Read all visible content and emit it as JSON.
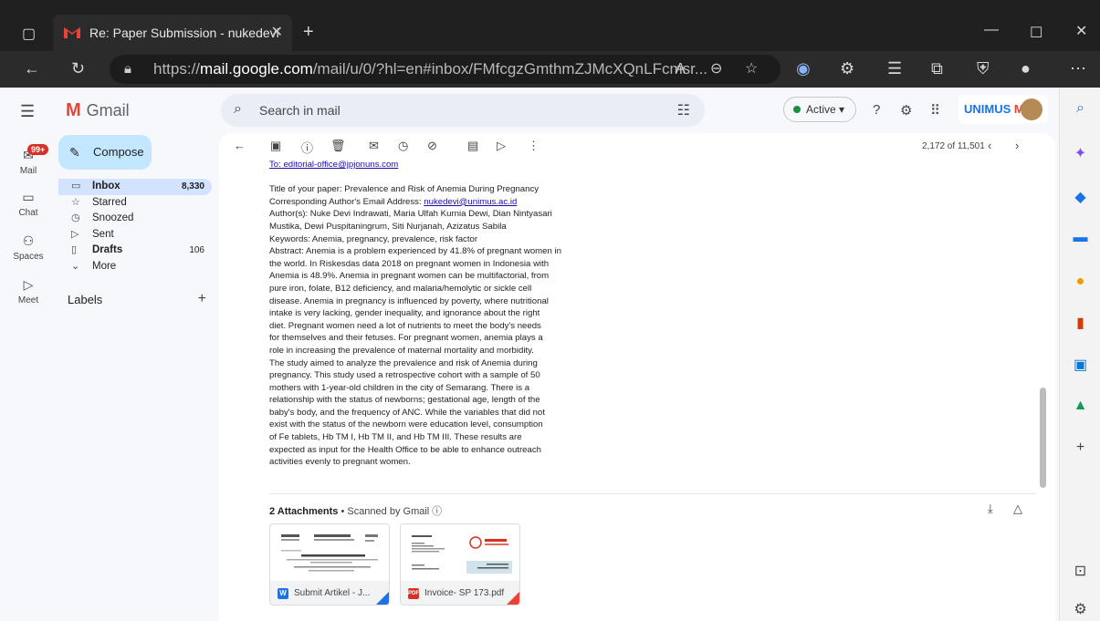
{
  "browser": {
    "tab_title": "Re: Paper Submission - nukedevi",
    "tab_close": "✕",
    "new_tab": "+",
    "url_prefix": "https://",
    "url_domain": "mail.google.com",
    "url_rest": "/mail/u/0/?hl=en#inbox/FMfcgzGmthmZJMcXQnLFcmsr..."
  },
  "gmail": {
    "app_name": "Gmail",
    "search_placeholder": "Search in mail",
    "status": "Active",
    "brand_text": "UNIMUS",
    "brand_mg": "MG"
  },
  "rail": {
    "mail": "Mail",
    "mail_badge": "99+",
    "chat": "Chat",
    "spaces": "Spaces",
    "meet": "Meet"
  },
  "sidebar": {
    "compose": "Compose",
    "folders": [
      {
        "label": "Inbox",
        "count": "8,330"
      },
      {
        "label": "Starred",
        "count": ""
      },
      {
        "label": "Snoozed",
        "count": ""
      },
      {
        "label": "Sent",
        "count": ""
      },
      {
        "label": "Drafts",
        "count": "106"
      },
      {
        "label": "More",
        "count": ""
      }
    ],
    "labels_title": "Labels"
  },
  "toolbar": {
    "pager": "2,172 of 11,501"
  },
  "email": {
    "to_line": "To: editorial-office@jpjonuns.com",
    "paper_title": "Title of your paper: Prevalence and Risk of Anemia During Pregnancy",
    "corr_prefix": "Corresponding Author's Email Address: ",
    "corr_email": "nukedevi@unimus.ac.id",
    "authors_1": "Author(s): Nuke Devi Indrawati, Maria Ulfah Kurnia Dewi, Dian Nintyasari",
    "authors_2": "Mustika, Dewi Puspitaningrum, Siti Nurjanah, Azizatus Sabila",
    "keywords": "Keywords: Anemia, pregnancy, prevalence, risk factor",
    "abstract_lines": [
      "Abstract: Anemia is a problem experienced by 41.8% of pregnant women in",
      "the world. In Riskesdas data 2018 on pregnant women in Indonesia with",
      "Anemia is 48.9%. Anemia in pregnant women can be multifactorial, from",
      "pure iron, folate, B12 deficiency, and malaria/hemolytic or sickle cell",
      "disease. Anemia in pregnancy is influenced by poverty, where nutritional",
      "intake is very lacking, gender inequality, and ignorance about the right",
      "diet. Pregnant women need a lot of nutrients to meet the body's needs",
      "for themselves and their fetuses. For pregnant women, anemia plays a",
      "role in increasing the prevalence of maternal mortality and morbidity.",
      "The study aimed to analyze the prevalence and risk of Anemia during",
      "pregnancy. This study used a retrospective cohort with a sample of 50",
      "mothers with 1-year-old children in the city of Semarang. There is a",
      "relationship with the status of newborns; gestational age, length of the",
      "baby's body, and the frequency of ANC. While the variables that did not",
      "exist with the status of the newborn were education level, consumption",
      "of Fe tablets, Hb TM I, Hb TM II, and Hb TM III. These results are",
      "expected as input for the Health Office to be able to enhance outreach",
      "activities evenly to pregnant women."
    ]
  },
  "attachments": {
    "header": "2 Attachments",
    "scanned": " • Scanned by Gmail ⓘ",
    "files": [
      {
        "name": "Submit Artikel - J...",
        "type": "W"
      },
      {
        "name": "Invoice- SP 173.pdf",
        "type": "PDF"
      }
    ]
  },
  "colors": {
    "accent": "#1a73e8",
    "compose_bg": "#c2e7ff",
    "selected_bg": "#d3e3fd",
    "badge": "#d93025"
  }
}
